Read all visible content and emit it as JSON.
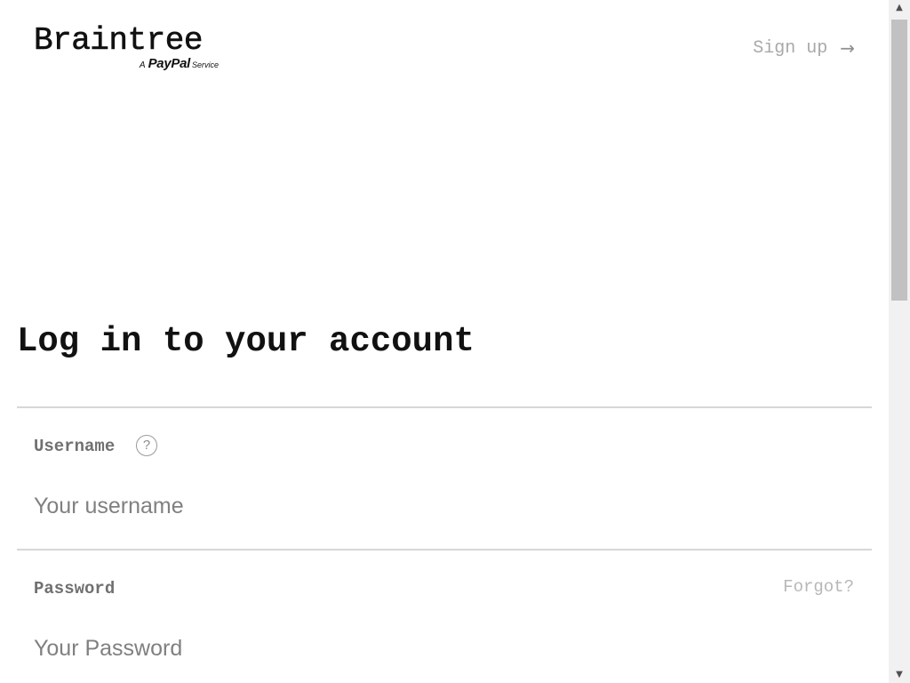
{
  "header": {
    "logo": {
      "wordmark": "Braintree",
      "tagline_prefix": "A",
      "tagline_brand": "PayPal",
      "tagline_suffix": "Service"
    },
    "signup_label": "Sign up",
    "signup_icon": "arrow-right-icon"
  },
  "main": {
    "heading": "Log in to your account",
    "username": {
      "label": "Username",
      "help_icon": "?",
      "placeholder": "Your username",
      "value": ""
    },
    "password": {
      "label": "Password",
      "forgot_label": "Forgot?",
      "placeholder": "Your Password",
      "value": ""
    }
  },
  "scrollbar": {
    "up_icon": "▲",
    "down_icon": "▼"
  },
  "colors": {
    "text_primary": "#111111",
    "text_muted": "#707070",
    "link_muted": "#a9a9a9",
    "divider": "#d7d7d7",
    "background": "#ffffff"
  }
}
